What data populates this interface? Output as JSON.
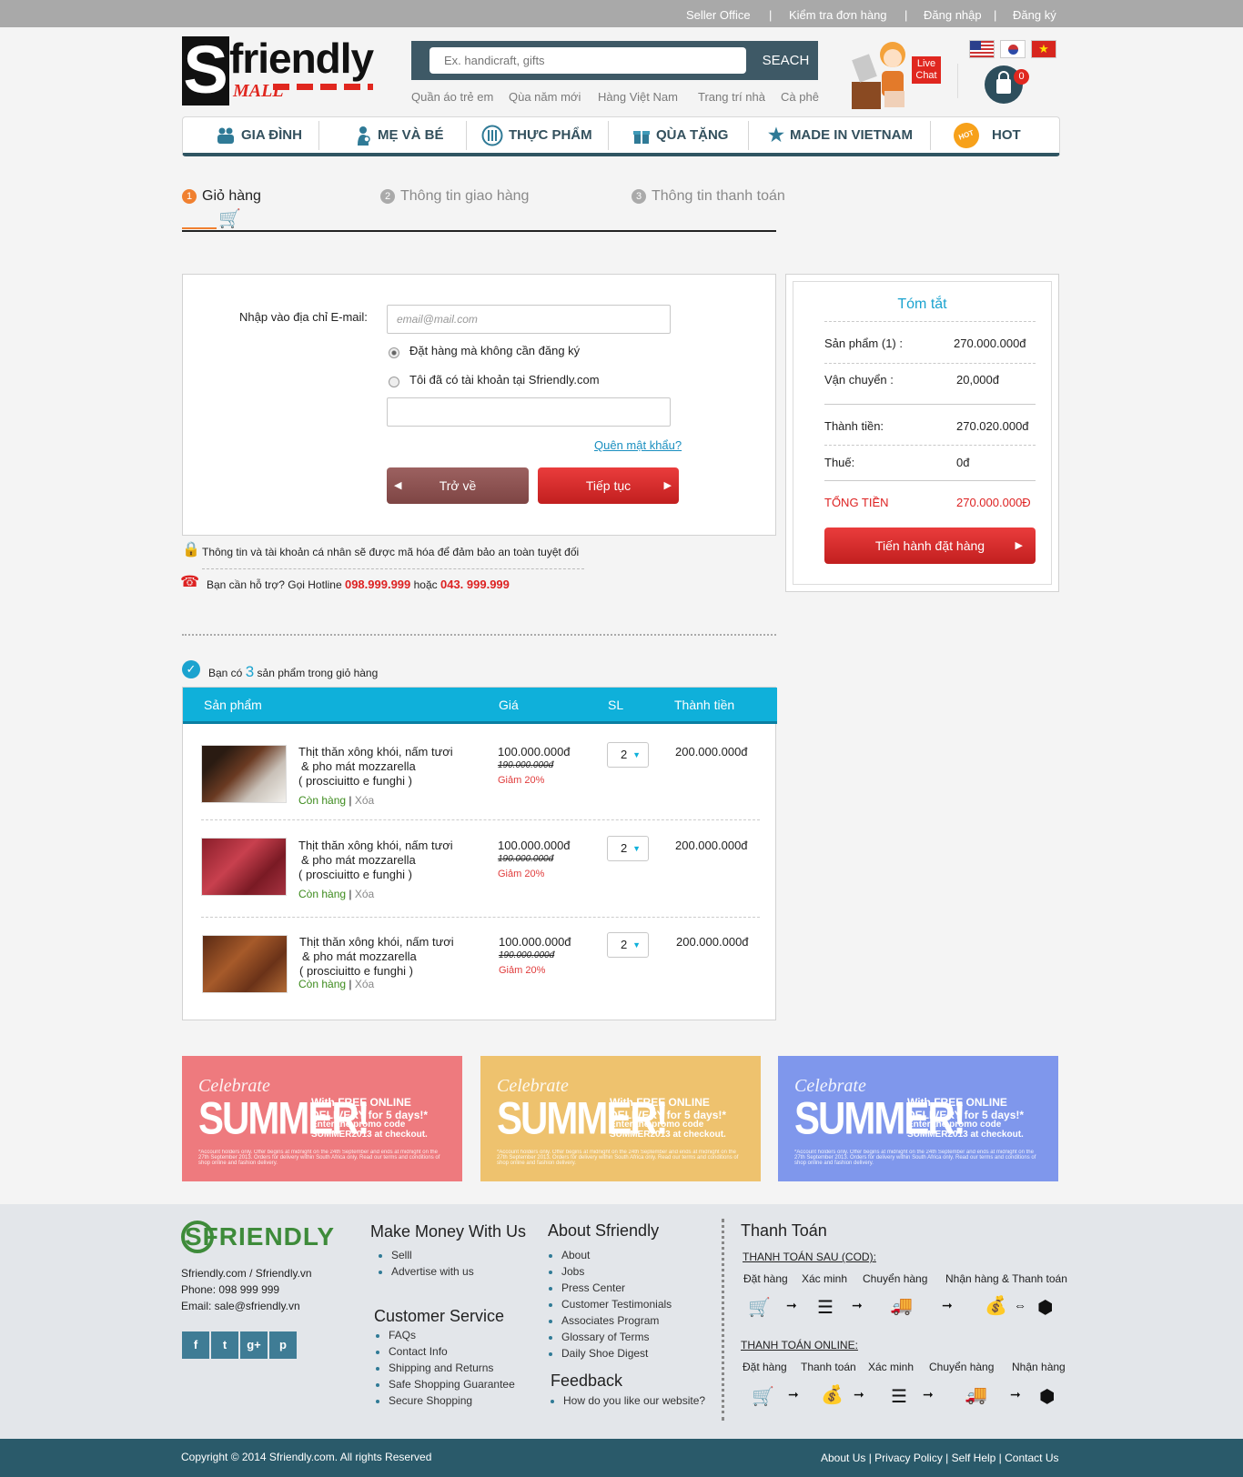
{
  "topbar": {
    "links": [
      "Seller  Office",
      "Kiểm tra đơn hàng",
      "Đăng nhập",
      "Đăng ký"
    ]
  },
  "logo": {
    "letter": "S",
    "word": "friendly",
    "sub": "MALL"
  },
  "search": {
    "placeholder": "Ex. handicraft, gifts",
    "button": "SEACH",
    "keywords": [
      "Quần áo trẻ em",
      "Qùa năm mới",
      "Hàng Việt Nam",
      "Trang trí nhà",
      "Cà phê"
    ]
  },
  "livechat": {
    "label": "Live Chat"
  },
  "cart": {
    "count": "0"
  },
  "nav": [
    {
      "label": "GIA ĐÌNH",
      "icon": "family-icon"
    },
    {
      "label": "MẸ VÀ BÉ",
      "icon": "mother-baby-icon"
    },
    {
      "label": "THỰC PHẨM",
      "icon": "food-icon"
    },
    {
      "label": "QÙA TẶNG",
      "icon": "gift-icon"
    },
    {
      "label": "MADE IN VIETNAM",
      "icon": "star-icon"
    },
    {
      "label": "HOT",
      "icon": "hot-icon",
      "badge": "HOT"
    }
  ],
  "steps": [
    {
      "num": "1",
      "label": "Giỏ hàng"
    },
    {
      "num": "2",
      "label": "Thông tin giao hàng"
    },
    {
      "num": "3",
      "label": "Thông tin thanh toán"
    }
  ],
  "login": {
    "email_label": "Nhập vào địa chỉ E-mail:",
    "email_placeholder": "email@mail.com",
    "opt_guest": "Đặt hàng mà không cần đăng ký",
    "opt_account": "Tôi đã có tài khoản tại Sfriendly.com",
    "forgot": "Quên mật khẩu?",
    "back": "Trở về",
    "next": "Tiếp tục"
  },
  "security_note": "Thông tin và tài khoản cá nhân sẽ được mã hóa để đảm bảo an toàn tuyệt đối",
  "hotline": {
    "prefix": "Bạn cần hỗ trợ? Gọi Hotline",
    "phone1": "098.999.999",
    "mid": "hoặc",
    "phone2": "043. 999.999"
  },
  "summary": {
    "title": "Tóm tắt",
    "rows": [
      {
        "label": "Sản phẩm (1) :",
        "value": "270.000.000đ"
      },
      {
        "label": "Vận chuyển :",
        "value": "20,000đ"
      },
      {
        "label": "Thành tiền:",
        "value": "270.020.000đ"
      },
      {
        "label": "Thuế:",
        "value": "0đ"
      }
    ],
    "total_label": "TỔNG TIỀN",
    "total_value": "270.000.000Đ",
    "checkout": "Tiến hành đặt hàng"
  },
  "cart_info": {
    "prefix": "Bạn có",
    "count": "3",
    "suffix": "sản phẩm trong giỏ hàng"
  },
  "table": {
    "headers": [
      "Sản phẩm",
      "Giá",
      "SL",
      "Thành tiền"
    ],
    "rows": [
      {
        "name1": "Thịt thăn xông khói, nấm tươi",
        "name2": "& pho mát mozzarella",
        "name3": "( prosciuitto e funghi )",
        "stock": "Còn hàng",
        "remove": "Xóa",
        "price": "100.000.000đ",
        "old": "190.000.000đ",
        "discount": "Giảm 20%",
        "qty": "2",
        "total": "200.000.000đ"
      },
      {
        "name1": "Thịt thăn xông khói, nấm tươi",
        "name2": "& pho mát mozzarella",
        "name3": "( prosciuitto e funghi )",
        "stock": "Còn hàng",
        "remove": "Xóa",
        "price": "100.000.000đ",
        "old": "190.000.000đ",
        "discount": "Giảm 20%",
        "qty": "2",
        "total": "200.000.000đ"
      },
      {
        "name1": "Thịt thăn xông khói, nấm tươi",
        "name2": "& pho mát mozzarella",
        "name3": "( prosciuitto e funghi )",
        "stock": "Còn hàng",
        "remove": "Xóa",
        "price": "100.000.000đ",
        "old": "190.000.000đ",
        "discount": "Giảm 20%",
        "qty": "2",
        "total": "200.000.000đ"
      }
    ]
  },
  "banners": [
    {
      "celebrate": "Celebrate",
      "summer": "SUMMER!",
      "line1": "With FREE ONLINE DELIVERY for 5 days!*",
      "line2": "Enter the promo code SUMMER2013 at checkout.",
      "fine": "*Account holders only. Offer begins at midnight on the 24th September and ends at midnight on the 27th September 2013. Orders for delivery within South Africa only. Read our terms and conditions of shop online and fashion delivery.",
      "color": "#ee7a7e"
    },
    {
      "celebrate": "Celebrate",
      "summer": "SUMMER!",
      "line1": "With FREE ONLINE DELIVERY for 5 days!*",
      "line2": "Enter the promo code SUMMER2013 at checkout.",
      "fine": "*Account holders only. Offer begins at midnight on the 24th September and ends at midnight on the 27th September 2013. Orders for delivery within South Africa only. Read our terms and conditions of shop online and fashion delivery.",
      "color": "#eec26e"
    },
    {
      "celebrate": "Celebrate",
      "summer": "SUMMER!",
      "line1": "With FREE ONLINE DELIVERY for 5 days!*",
      "line2": "Enter the promo code SUMMER2013 at checkout.",
      "fine": "*Account holders only. Offer begins at midnight on the 24th September and ends at midnight on the 27th September 2013. Orders for delivery within South Africa only. Read our terms and conditions of shop online and fashion delivery.",
      "color": "#7f97ec"
    }
  ],
  "footer": {
    "logo": "SFRIENDLY",
    "contact": [
      "Sfriendly.com / Sfriendly.vn",
      "Phone: 098 999 999",
      "Email: sale@sfriendly.vn"
    ],
    "social": [
      "f",
      "t",
      "g+",
      "p"
    ],
    "col1_title": "Make Money With Us",
    "col1": [
      "Selll",
      "Advertise with us"
    ],
    "col2_title": "Customer Service",
    "col2": [
      "FAQs",
      "Contact Info",
      "Shipping and Returns",
      "Safe Shopping Guarantee",
      "Secure Shopping"
    ],
    "col3_title": "About Sfriendly",
    "col3": [
      "About",
      "Jobs",
      "Press Center",
      "Customer Testimonials",
      "Associates Program",
      "Glossary of Terms",
      "Daily Shoe Digest"
    ],
    "col4_title": "Feedback",
    "col4": [
      "How do you like our website?"
    ],
    "pay_title": "Thanh Toán",
    "cod_title": "THANH TOÁN SAU (COD):",
    "cod_steps": [
      "Đặt hàng",
      "Xác minh",
      "Chuyển hàng",
      "Nhận hàng & Thanh toán"
    ],
    "online_title": "THANH TOÁN ONLINE:",
    "online_steps": [
      "Đặt hàng",
      "Thanh toán",
      "Xác minh",
      "Chuyển hàng",
      "Nhận hàng"
    ],
    "copyright": "Copyright © 2014 Sfriendly.com. All rights Reserved",
    "links": [
      "About Us",
      "Privacy Policy",
      "Self Help",
      "Contact Us"
    ]
  }
}
